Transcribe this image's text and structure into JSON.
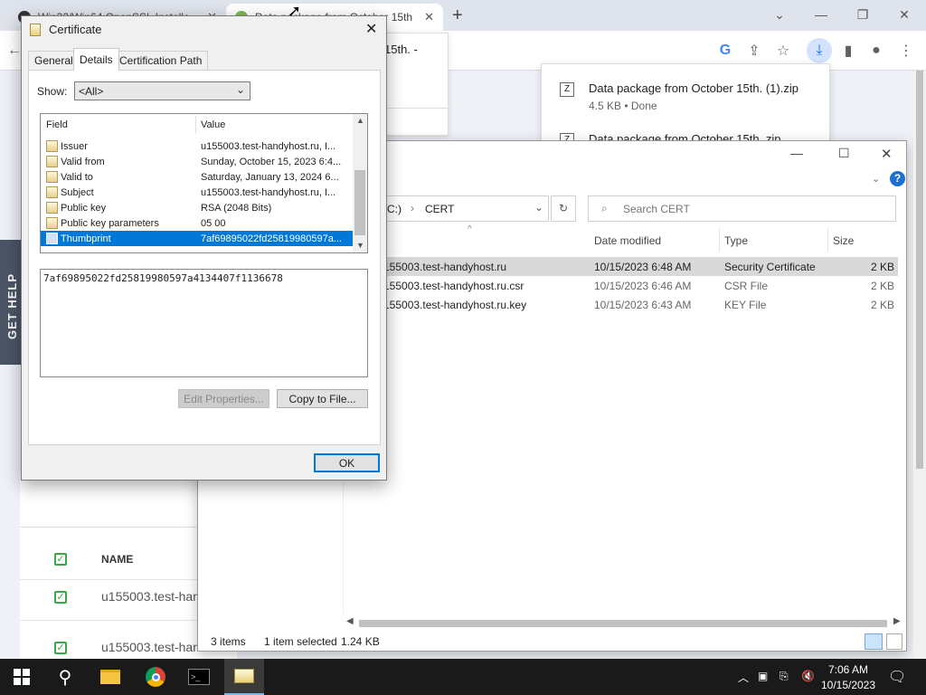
{
  "browser": {
    "tabs": [
      {
        "label": "Win32/Win64 OpenSSL Installe",
        "close": "✕"
      },
      {
        "label": "Data package from October 15th",
        "close": "✕"
      }
    ],
    "new_tab": "+",
    "popup_title_fragment": "15th. -"
  },
  "downloads": {
    "items": [
      {
        "name": "Data package from October 15th. (1).zip",
        "status": "4.5 KB • Done"
      },
      {
        "name": "Data package from October 15th..zip",
        "status": ""
      }
    ]
  },
  "page": {
    "help_label": "GET HELP",
    "table_header": "NAME",
    "rows": [
      "u155003.test-han",
      "u155003.test-han"
    ]
  },
  "explorer": {
    "path": [
      "C:)",
      "CERT"
    ],
    "search_placeholder": "Search CERT",
    "columns": [
      "Date modified",
      "Type",
      "Size"
    ],
    "files": [
      {
        "name": "155003.test-handyhost.ru",
        "date": "10/15/2023 6:48 AM",
        "type": "Security Certificate",
        "size": "2 KB",
        "selected": true
      },
      {
        "name": "155003.test-handyhost.ru.csr",
        "date": "10/15/2023 6:46 AM",
        "type": "CSR File",
        "size": "2 KB",
        "selected": false
      },
      {
        "name": "155003.test-handyhost.ru.key",
        "date": "10/15/2023 6:43 AM",
        "type": "KEY File",
        "size": "2 KB",
        "selected": false
      }
    ],
    "status": {
      "items": "3 items",
      "selected": "1 item selected",
      "size": "1.24 KB"
    }
  },
  "dialog": {
    "title": "Certificate",
    "tabs": [
      "General",
      "Details",
      "Certification Path"
    ],
    "show_label": "Show:",
    "show_value": "<All>",
    "col_field": "Field",
    "col_value": "Value",
    "fields": [
      {
        "name": "Issuer",
        "value": "u155003.test-handyhost.ru, I..."
      },
      {
        "name": "Valid from",
        "value": "Sunday, October 15, 2023 6:4..."
      },
      {
        "name": "Valid to",
        "value": "Saturday, January 13, 2024 6..."
      },
      {
        "name": "Subject",
        "value": "u155003.test-handyhost.ru, I..."
      },
      {
        "name": "Public key",
        "value": "RSA (2048 Bits)"
      },
      {
        "name": "Public key parameters",
        "value": "05 00"
      },
      {
        "name": "Thumbprint",
        "value": "7af69895022fd25819980597a..."
      }
    ],
    "detail_text": "7af69895022fd25819980597a4134407f1136678",
    "edit_properties": "Edit Properties...",
    "copy_to_file": "Copy to File...",
    "ok": "OK"
  },
  "taskbar": {
    "time": "7:06 AM",
    "date": "10/15/2023"
  }
}
